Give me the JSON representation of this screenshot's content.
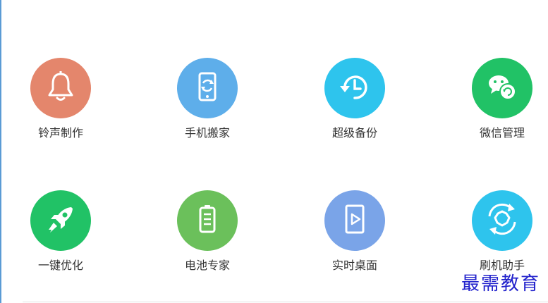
{
  "tools": [
    {
      "label": "铃声制作",
      "icon": "bell-icon",
      "color": "#e4866c"
    },
    {
      "label": "手机搬家",
      "icon": "phone-transfer-icon",
      "color": "#5eaeea"
    },
    {
      "label": "超级备份",
      "icon": "backup-clock-icon",
      "color": "#2ec4ed"
    },
    {
      "label": "微信管理",
      "icon": "wechat-icon",
      "color": "#21c266"
    },
    {
      "label": "一键优化",
      "icon": "rocket-icon",
      "color": "#21c266"
    },
    {
      "label": "电池专家",
      "icon": "battery-icon",
      "color": "#6bc05b"
    },
    {
      "label": "实时桌面",
      "icon": "live-desktop-icon",
      "color": "#7aa4e8"
    },
    {
      "label": "刷机助手",
      "icon": "flash-helper-icon",
      "color": "#2ec4ed"
    }
  ],
  "watermark": "最需教育"
}
